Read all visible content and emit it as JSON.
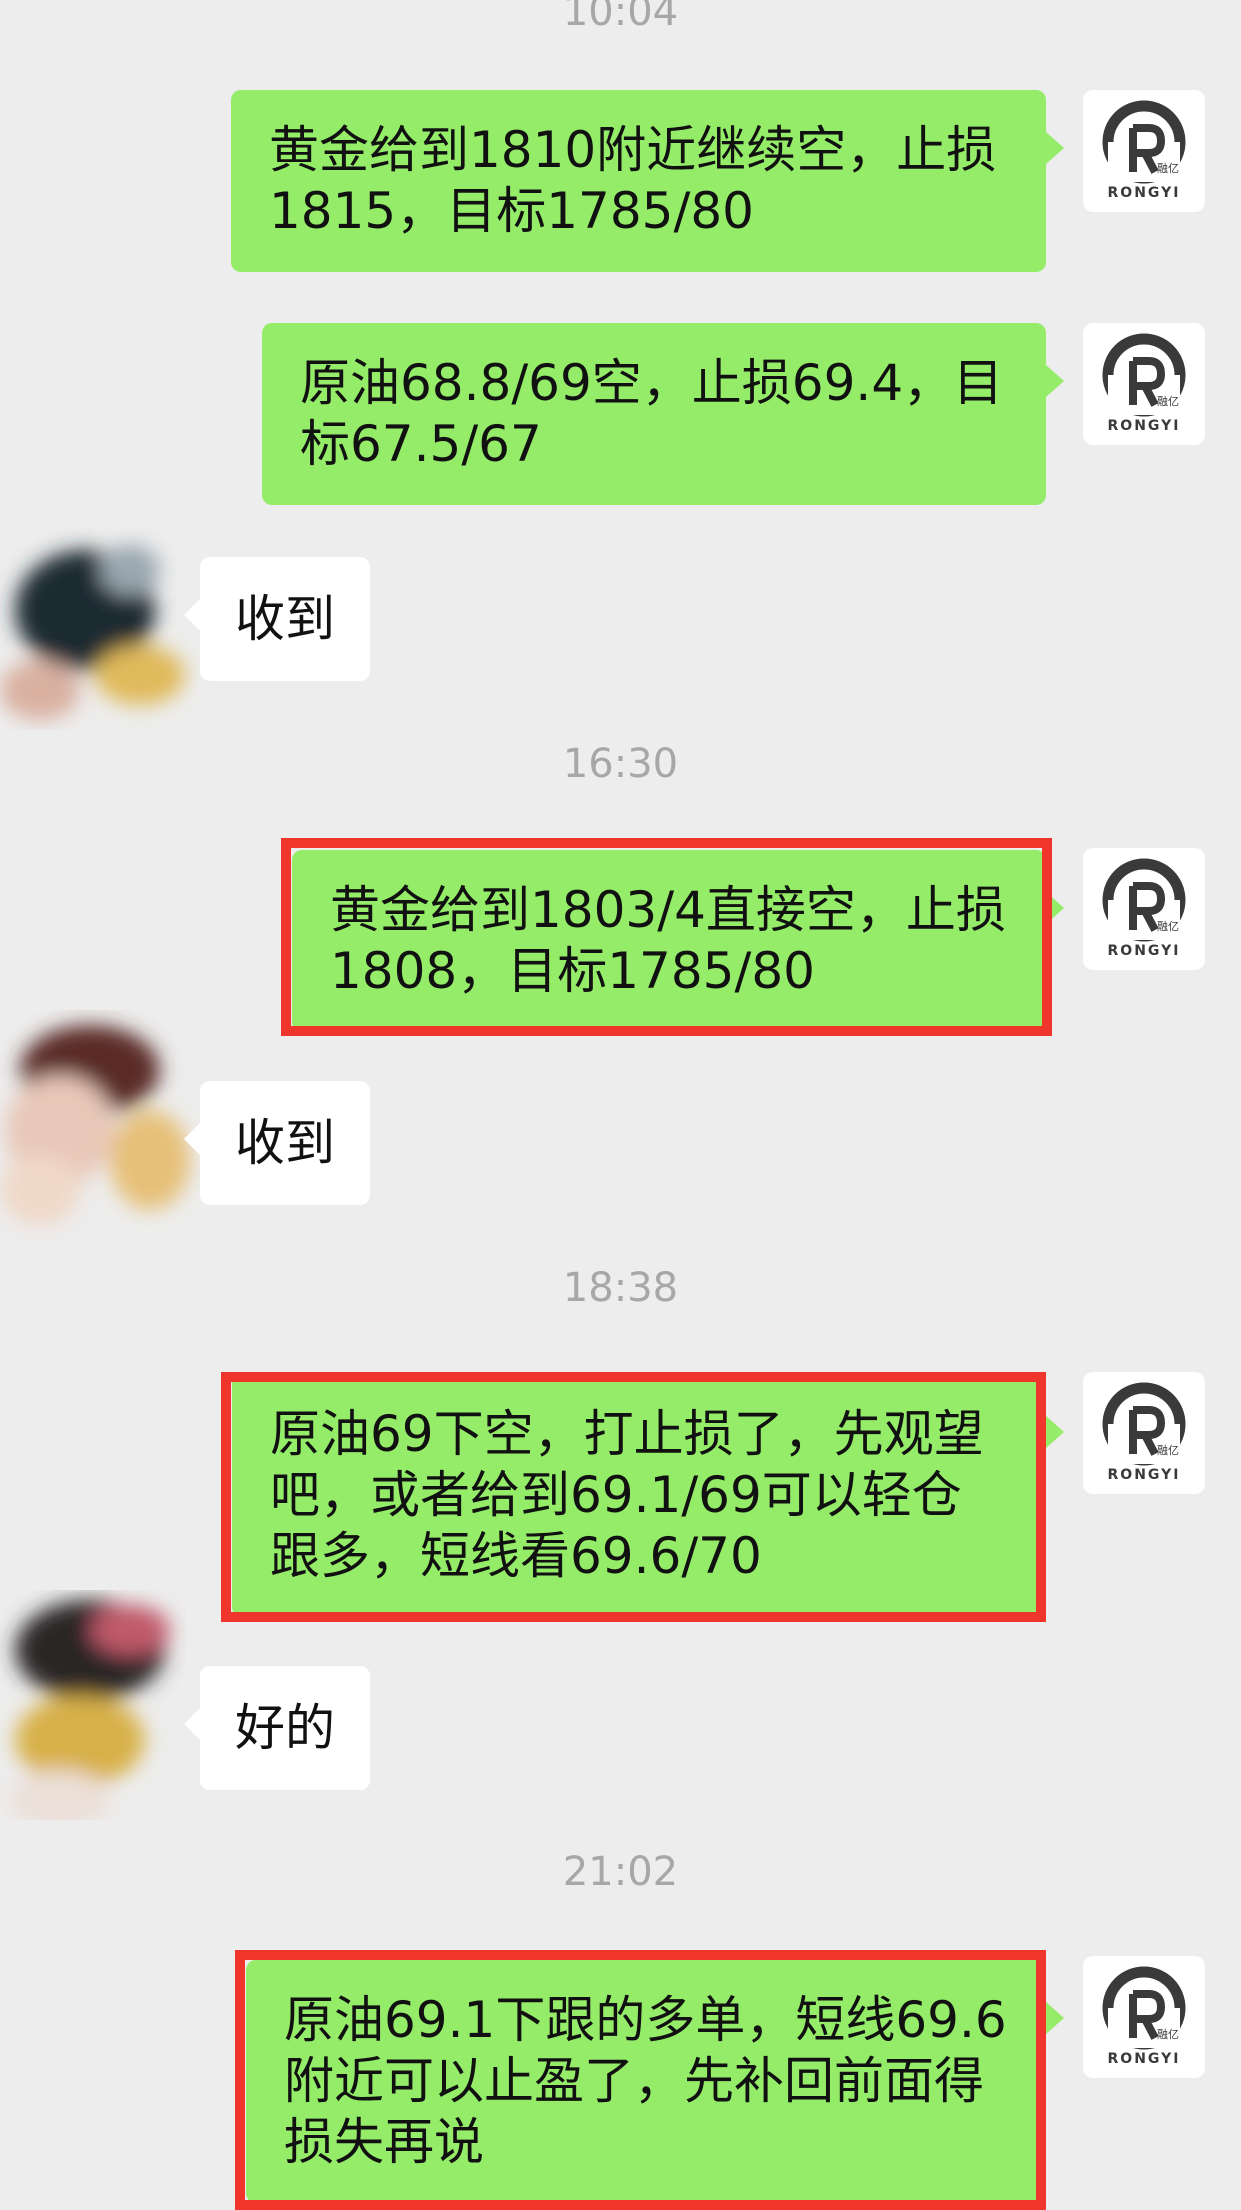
{
  "chat": {
    "messages": [
      {
        "type": "timestamp",
        "text": "10:04"
      },
      {
        "type": "sent",
        "text": "黄金给到1810附近继续空，止损1815，目标1785/80"
      },
      {
        "type": "sent",
        "text": "原油68.8/69空，止损69.4，目标67.5/67"
      },
      {
        "type": "received",
        "text": "收到"
      },
      {
        "type": "timestamp",
        "text": "16:30"
      },
      {
        "type": "sent",
        "text": "黄金给到1803/4直接空，止损1808，目标1785/80",
        "highlighted": true
      },
      {
        "type": "received",
        "text": "收到"
      },
      {
        "type": "timestamp",
        "text": "18:38"
      },
      {
        "type": "sent",
        "text": "原油69下空，打止损了，先观望吧，或者给到69.1/69可以轻仓跟多，短线看69.6/70",
        "highlighted": true
      },
      {
        "type": "received",
        "text": "好的"
      },
      {
        "type": "timestamp",
        "text": "21:02"
      },
      {
        "type": "sent",
        "text": "原油69.1下跟的多单，短线69.6附近可以止盈了，先补回前面得损失再说",
        "highlighted": true
      }
    ]
  },
  "logo": {
    "brand": "RONGYI",
    "chinese": "融亿",
    "color": "#3a3a3a"
  },
  "colors": {
    "sent_bubble": "#95ec69",
    "received_bubble": "#ffffff",
    "background": "#ededed",
    "highlight": "#f0352d",
    "timestamp": "#a7a7a7"
  }
}
